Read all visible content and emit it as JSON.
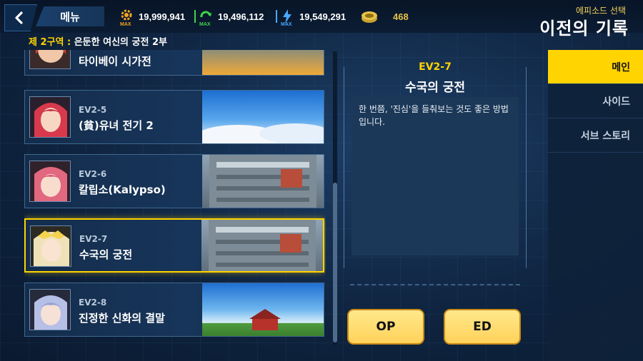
{
  "header": {
    "menu_label": "메뉴",
    "resources": [
      {
        "icon": "gear-icon",
        "color": "#f5a623",
        "max_label": "MAX",
        "value": "19,999,941"
      },
      {
        "icon": "recycle-icon",
        "color": "#3fd44a",
        "max_label": "MAX",
        "value": "19,496,112"
      },
      {
        "icon": "lightning-icon",
        "color": "#4aa8ff",
        "max_label": "MAX",
        "value": "19,549,291"
      },
      {
        "icon": "coin-stack-icon",
        "color": "#e7c24a",
        "value": "468"
      }
    ],
    "subtitle": "에피소드 선택",
    "title": "이전의 기록"
  },
  "zone": {
    "label": "제 2구역",
    "separator": " : ",
    "name": "은둔한 여신의 궁전 2부"
  },
  "episodes": [
    {
      "code": "",
      "name": "타이베이 시가전",
      "selected": false
    },
    {
      "code": "EV2-5",
      "name": "(貧)유녀 전기 2",
      "selected": false
    },
    {
      "code": "EV2-6",
      "name": "칼립소(Kalypso)",
      "selected": false
    },
    {
      "code": "EV2-7",
      "name": "수국의 궁전",
      "selected": true
    },
    {
      "code": "EV2-8",
      "name": "진정한 신화의 결말",
      "selected": false
    }
  ],
  "detail": {
    "code": "EV2-7",
    "title": "수국의 궁전",
    "description": "한 번쯤, '진심'을 들춰보는 것도 좋은 방법입니다.",
    "op_label": "OP",
    "ed_label": "ED"
  },
  "tabs": [
    {
      "label": "메인",
      "active": true
    },
    {
      "label": "사이드",
      "active": false
    },
    {
      "label": "서브 스토리",
      "active": false
    }
  ],
  "colors": {
    "accent": "#ffd400",
    "button": "#ffd25a",
    "panel": "#1c3858",
    "background": "#0f2440"
  }
}
